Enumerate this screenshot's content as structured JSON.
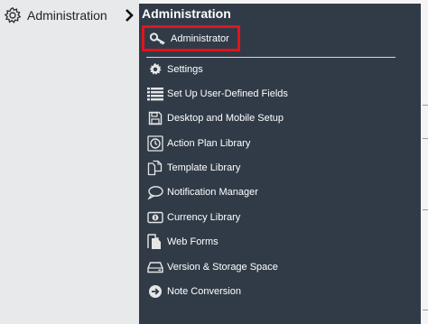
{
  "sidebar": {
    "administration_label": "Administration",
    "icon": "gear-icon",
    "expand_icon": "chevron-right-icon"
  },
  "menu": {
    "title": "Administration",
    "highlighted": {
      "label": "Administrator",
      "icon": "key-icon",
      "highlight_color": "#e2141d"
    },
    "items": [
      {
        "label": "Settings",
        "icon": "gear-icon"
      },
      {
        "label": "Set Up User-Defined Fields",
        "icon": "list-icon"
      },
      {
        "label": "Desktop and Mobile Setup",
        "icon": "save-icon"
      },
      {
        "label": "Action Plan Library",
        "icon": "clock-icon"
      },
      {
        "label": "Template Library",
        "icon": "copy-icon"
      },
      {
        "label": "Notification Manager",
        "icon": "speech-bubble-icon"
      },
      {
        "label": "Currency Library",
        "icon": "currency-icon"
      },
      {
        "label": "Web Forms",
        "icon": "document-icon"
      },
      {
        "label": "Version & Storage Space",
        "icon": "drive-icon"
      },
      {
        "label": "Note Conversion",
        "icon": "arrow-circle-icon"
      }
    ]
  },
  "colors": {
    "menu_background": "#313b48",
    "sidebar_background": "#e7e9ea",
    "menu_text": "#ffffff"
  }
}
